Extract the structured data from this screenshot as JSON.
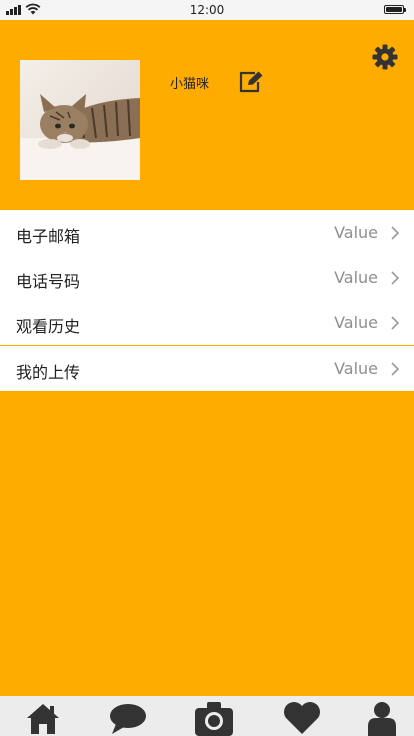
{
  "status_bar": {
    "time": "12:00"
  },
  "profile": {
    "username": "小猫咪"
  },
  "list": {
    "items": [
      {
        "label": "电子邮箱",
        "value": "Value"
      },
      {
        "label": "电话号码",
        "value": "Value"
      },
      {
        "label": "观看历史",
        "value": "Value"
      },
      {
        "label": "我的上传",
        "value": "Value"
      }
    ]
  },
  "tab_bar": {
    "icons": [
      "home-icon",
      "chat-icon",
      "camera-icon",
      "heart-icon",
      "user-icon"
    ]
  },
  "colors": {
    "accent": "#ffab00",
    "value_text": "#8f8f8f",
    "icon_dark": "#333333"
  }
}
